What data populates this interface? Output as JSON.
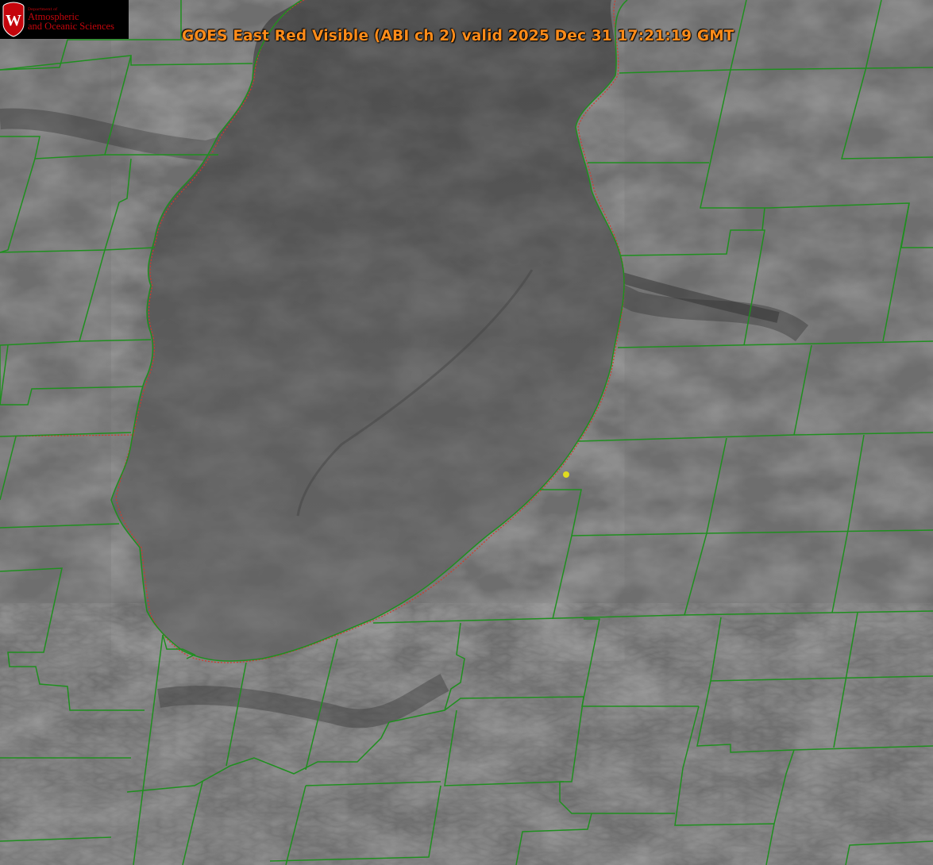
{
  "title": "GOES East Red Visible (ABI ch 2) valid 2025 Dec 31 17:21:19 GMT",
  "logo": {
    "department": "Department of",
    "line1": "Atmospheric",
    "line2": "and Oceanic Sciences",
    "crest_letter": "W"
  },
  "colors": {
    "title": "#ff8c1a",
    "boundary": "#1f8f1f",
    "state_line": "#d23a2a",
    "marker": "#e0dc20",
    "logo_text": "#c5050c"
  },
  "icons": [
    "uw-crest-icon",
    "location-marker-icon"
  ]
}
